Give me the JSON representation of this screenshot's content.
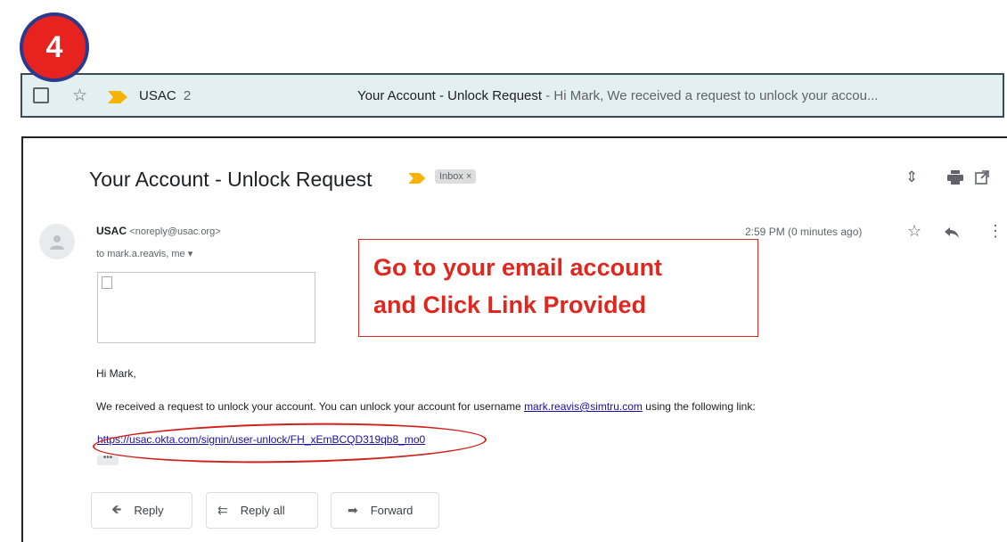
{
  "step_number": "4",
  "inbox_row": {
    "sender": "USAC",
    "count": "2",
    "subject": "Your Account - Unlock Request",
    "separator": " - ",
    "snippet": "Hi Mark, We received a request to unlock your accou..."
  },
  "email": {
    "subject": "Your Account - Unlock Request",
    "label": "Inbox ×",
    "sender_name": "USAC",
    "sender_email": "<noreply@usac.org>",
    "to": "to mark.a.reavis, me",
    "time": "2:59 PM (0 minutes ago)",
    "greeting": "Hi Mark,",
    "body_prefix": "We received a request to unlock your account. You can unlock your account for username ",
    "body_email": "mark.reavis@simtru.com",
    "body_suffix": " using the following link:",
    "unlock_link": "https://usac.okta.com/signin/user-unlock/FH_xEmBCQD319qb8_mo0",
    "ellipsis": "•••"
  },
  "callout": {
    "line1": "Go to your email account",
    "line2": "and Click Link Provided"
  },
  "actions": {
    "reply": "Reply",
    "reply_all": "Reply all",
    "forward": "Forward"
  },
  "colors": {
    "badge": "#e8231f",
    "badge_border": "#2a3a8c",
    "inbox_row_bg": "#e2f0f2",
    "importance_marker": "#f4b400",
    "annotation_red": "#e0271f",
    "link_blue": "#1a0dab"
  }
}
